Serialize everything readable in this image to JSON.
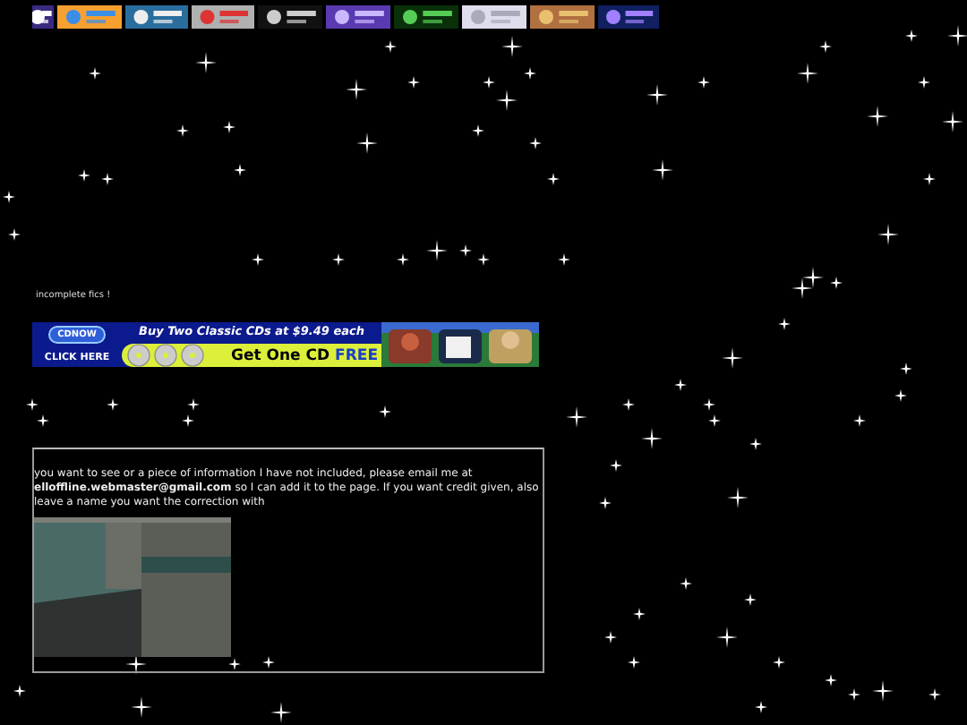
{
  "note": "incomplete fics !",
  "ad": {
    "brand": "CDNOW",
    "cta": "CLICK HERE",
    "headline": "Buy Two Classic CDs at $9.49 each",
    "offer": "Get One CD",
    "offer_highlight": "FREE"
  },
  "info_box": {
    "text_before": "you want to see or a piece of information I have not included, please email me at",
    "email": "elloffline.webmaster@gmail.com",
    "text_after": "so I can add it to the page. If you want credit given, also leave a name you want the correction with"
  }
}
